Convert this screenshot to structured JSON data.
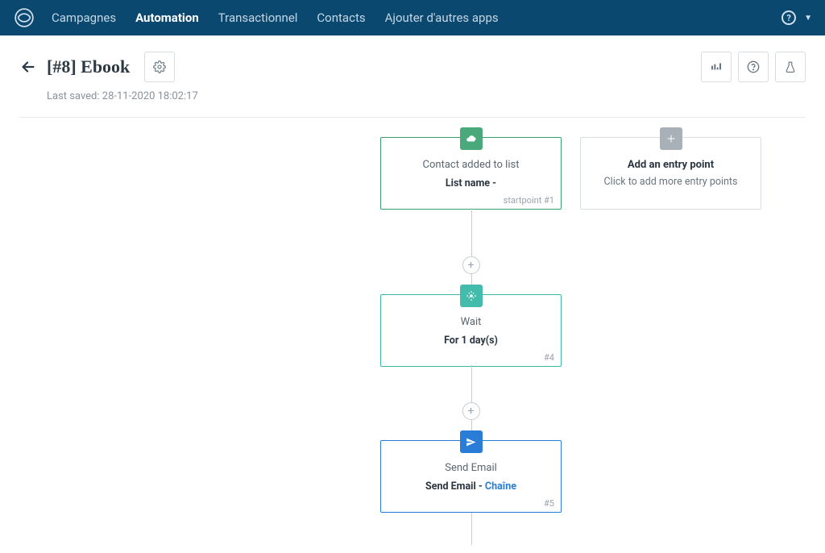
{
  "nav": [
    {
      "label": "Campagnes",
      "active": false
    },
    {
      "label": "Automation",
      "active": true
    },
    {
      "label": "Transactionnel",
      "active": false
    },
    {
      "label": "Contacts",
      "active": false
    },
    {
      "label": "Ajouter d'autres apps",
      "active": false
    }
  ],
  "page_title": "[#8] Ebook",
  "last_saved": "Last saved: 28-11-2020 18:02:17",
  "blocks": {
    "start": {
      "title": "Contact added to list",
      "sub": "List name -",
      "badge": "startpoint #1"
    },
    "entry": {
      "title": "Add an entry point",
      "sub": "Click to add more entry points"
    },
    "wait": {
      "title": "Wait",
      "sub": "For 1 day(s)",
      "badge": "#4"
    },
    "email": {
      "title": "Send Email",
      "sub_prefix": "Send Email - ",
      "sub_link": "Chaîne",
      "badge": "#5"
    }
  }
}
